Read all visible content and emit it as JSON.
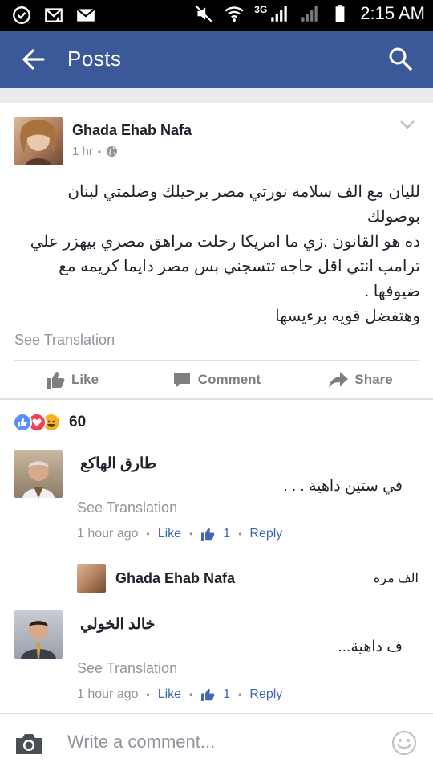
{
  "status_bar": {
    "time": "2:15 AM",
    "network": "3G"
  },
  "app_bar": {
    "title": "Posts"
  },
  "post": {
    "author": "Ghada Ehab Nafa",
    "time": "1 hr",
    "text": "لليان مع الف سلامه نورتي مصر برحيلك وضلمتي لبنان بوصولك\nده هو القانون .زي ما امريكا رحلت مراهق مصري بيهزر علي ترامب انتي اقل حاجه تتسجني بس مصر دايما كريمه مع ضيوفها .\nوهتفضل قويه برءيسها",
    "see_translation": "See Translation",
    "actions": {
      "like": "Like",
      "comment": "Comment",
      "share": "Share"
    }
  },
  "reactions": {
    "count": "60"
  },
  "comments": [
    {
      "name": "طارق الهاكع",
      "text": "في ستين داهية . . .",
      "see_translation": "See Translation",
      "time": "1 hour ago",
      "like": "Like",
      "likes": "1",
      "reply": "Reply"
    },
    {
      "name": "خالد الخولي",
      "text": "ف داهية...",
      "see_translation": "See Translation",
      "time": "1 hour ago",
      "like": "Like",
      "likes": "1",
      "reply": "Reply"
    }
  ],
  "reply_preview": {
    "name": "Ghada Ehab Nafa",
    "text": "الف مره"
  },
  "composer": {
    "placeholder": "Write a comment..."
  },
  "colors": {
    "brand": "#3b5998",
    "link": "#4267b2",
    "muted": "#90949c"
  }
}
